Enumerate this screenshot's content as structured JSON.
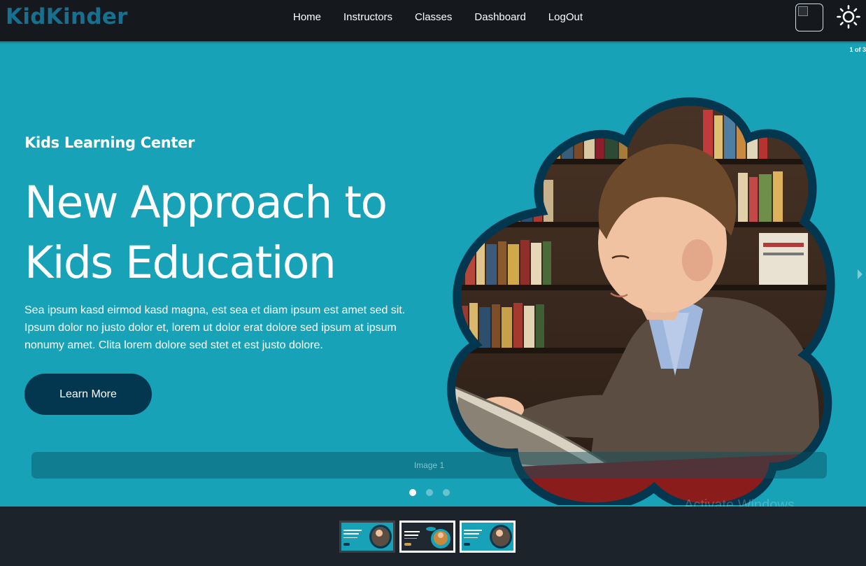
{
  "navbar": {
    "brand": "KidKinder",
    "links": [
      "Home",
      "Instructors",
      "Classes",
      "Dashboard",
      "LogOut"
    ],
    "avatar_icon": "broken-image-avatar",
    "theme_icon": "sun-icon"
  },
  "carousel": {
    "status": "1 of 3",
    "subtitle": "Kids Learning Center",
    "headline_line1": "New Approach to",
    "headline_line2": "Kids Education",
    "description": "Sea ipsum kasd eirmod kasd magna, est sea et diam ipsum est amet sed sit. Ipsum dolor no justo dolor et, lorem ut dolor erat dolore sed ipsum at ipsum nonumy amet. Clita lorem dolore sed stet et est justo dolore.",
    "cta_label": "Learn More",
    "caption": "Image 1",
    "slide_count": 3,
    "active_slide": 1,
    "watermark": "Activate Windows",
    "colors": {
      "background": "#17a2b8",
      "button": "#03364f",
      "frame": "#03364f",
      "brand": "#17708f"
    }
  },
  "thumbnails": [
    {
      "selected": false
    },
    {
      "selected": true
    },
    {
      "selected": true
    }
  ]
}
